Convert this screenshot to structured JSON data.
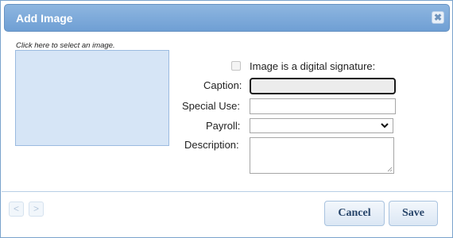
{
  "dialog": {
    "title": "Add Image",
    "close_glyph": "✖"
  },
  "image_panel": {
    "hint": "Click here to select an image."
  },
  "form": {
    "digital_signature": {
      "label": "Image is a digital signature:",
      "checked": false
    },
    "caption": {
      "label": "Caption:",
      "value": ""
    },
    "special_use": {
      "label": "Special Use:",
      "value": ""
    },
    "payroll": {
      "label": "Payroll:",
      "selected": ""
    },
    "description": {
      "label": "Description:",
      "value": ""
    }
  },
  "footer": {
    "prev_glyph": "<",
    "next_glyph": ">",
    "cancel_label": "Cancel",
    "save_label": "Save"
  },
  "icons": {
    "close": "close-icon",
    "dropdown": "chevron-down-icon",
    "prev": "chevron-left-icon",
    "next": "chevron-right-icon",
    "resize": "resize-grip-icon"
  },
  "colors": {
    "titlebar": "#7ba8d9",
    "image_area": "#d6e5f6",
    "button_text": "#27456a"
  }
}
